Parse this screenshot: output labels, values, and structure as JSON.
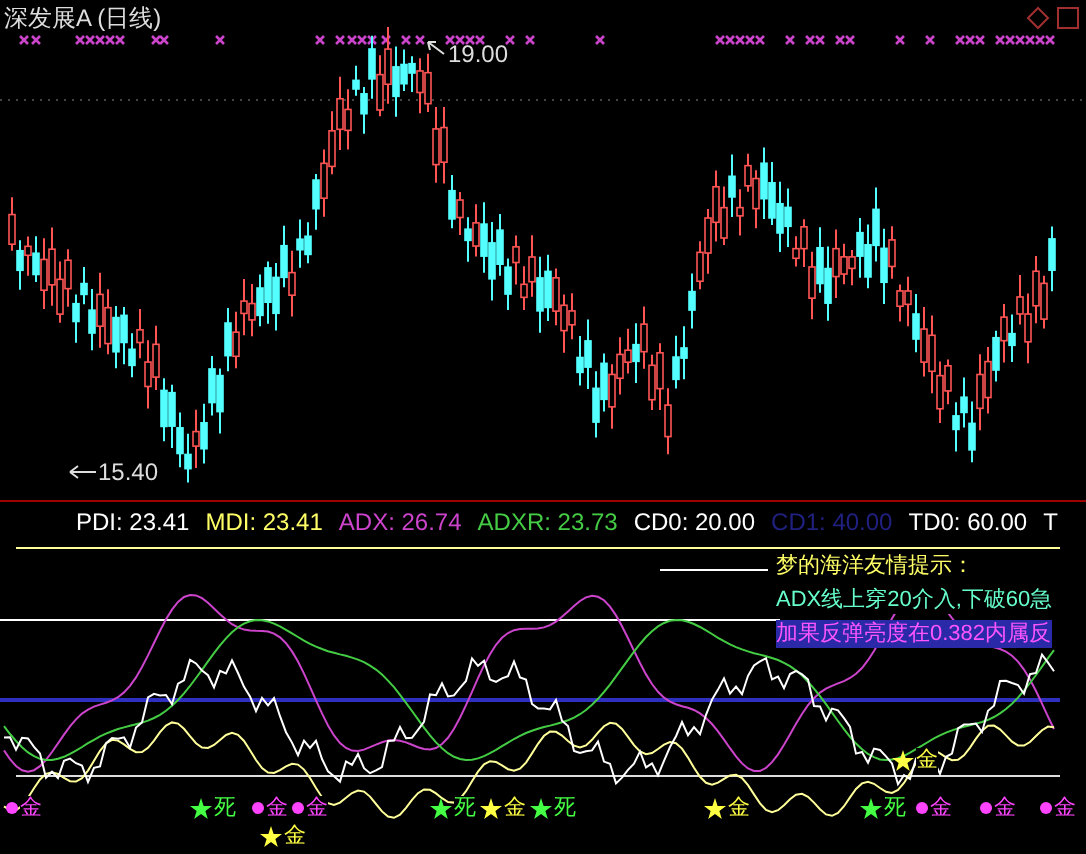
{
  "title": "深发展A (日线)",
  "price_labels": [
    {
      "kind": "high",
      "text": "19.00"
    },
    {
      "kind": "low",
      "text": "15.40"
    }
  ],
  "legend": [
    {
      "text": "PDI: 23.41",
      "color": "#ffffff"
    },
    {
      "text": "MDI: 23.41",
      "color": "#ffff66"
    },
    {
      "text": "ADX: 26.74",
      "color": "#cc44cc"
    },
    {
      "text": "ADXR: 23.73",
      "color": "#44cc44"
    },
    {
      "text": "CD0: 20.00",
      "color": "#ffffff"
    },
    {
      "text": "CD1: 40.00",
      "color": "#202080"
    },
    {
      "text": "TD0: 60.00",
      "color": "#ffffff"
    },
    {
      "text": "T",
      "color": "#ffffff"
    }
  ],
  "hints": [
    {
      "kind": "heading",
      "text": "梦的海洋友情提示："
    },
    {
      "kind": "entry",
      "text": "ADX线上穿20介入,下破60急"
    },
    {
      "kind": "warning",
      "text": "加果反弹亮度在0.382内属反"
    }
  ],
  "signals": [
    {
      "kind": "dot",
      "color": "#ff44ff",
      "text": "金"
    },
    {
      "kind": "star",
      "color": "#44ff44",
      "text": "死"
    },
    {
      "kind": "dot",
      "color": "#ff44ff",
      "text": "金"
    },
    {
      "kind": "dot",
      "color": "#ff44ff",
      "text": "金"
    },
    {
      "kind": "star",
      "color": "#ffff44",
      "text": "金"
    },
    {
      "kind": "star",
      "color": "#44ff44",
      "text": "死"
    },
    {
      "kind": "star",
      "color": "#ffff44",
      "text": "金"
    },
    {
      "kind": "star",
      "color": "#44ff44",
      "text": "死"
    },
    {
      "kind": "star",
      "color": "#ffff44",
      "text": "金"
    },
    {
      "kind": "star",
      "color": "#44ff44",
      "text": "死"
    },
    {
      "kind": "star",
      "color": "#ffff44",
      "text": "金"
    },
    {
      "kind": "dot",
      "color": "#ff44ff",
      "text": "金"
    },
    {
      "kind": "dot",
      "color": "#ff44ff",
      "text": "金"
    },
    {
      "kind": "dot",
      "color": "#ff44ff",
      "text": "金"
    }
  ]
}
